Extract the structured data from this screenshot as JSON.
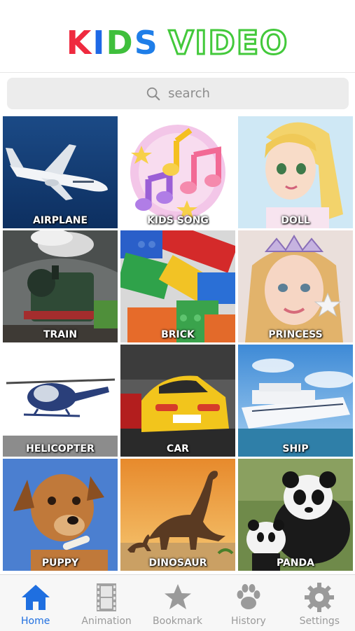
{
  "header": {
    "logo_kids": [
      "K",
      "I",
      "D",
      "S"
    ],
    "logo_video": "VIDEO"
  },
  "colors": {
    "logo_k": "#ef2a3f",
    "logo_i": "#1e68e6",
    "logo_d": "#3fbf3c",
    "logo_s": "#1f7ee8",
    "logo_video_outline": "#43c93b",
    "active_tab": "#1f6fe0",
    "inactive_tab": "#9a9a9a"
  },
  "search": {
    "placeholder": "search"
  },
  "grid": {
    "tiles": [
      {
        "label": "AIRPLANE"
      },
      {
        "label": "KIDS SONG"
      },
      {
        "label": "DOLL"
      },
      {
        "label": "TRAIN"
      },
      {
        "label": "BRICK"
      },
      {
        "label": "PRINCESS"
      },
      {
        "label": "HELICOPTER"
      },
      {
        "label": "CAR"
      },
      {
        "label": "SHIP"
      },
      {
        "label": "PUPPY"
      },
      {
        "label": "DINOSAUR"
      },
      {
        "label": "PANDA"
      }
    ]
  },
  "tabbar": {
    "tabs": [
      {
        "label": "Home",
        "icon": "home-icon",
        "active": true
      },
      {
        "label": "Animation",
        "icon": "film-icon",
        "active": false
      },
      {
        "label": "Bookmark",
        "icon": "star-icon",
        "active": false
      },
      {
        "label": "History",
        "icon": "paw-icon",
        "active": false
      },
      {
        "label": "Settings",
        "icon": "gear-icon",
        "active": false
      }
    ]
  }
}
